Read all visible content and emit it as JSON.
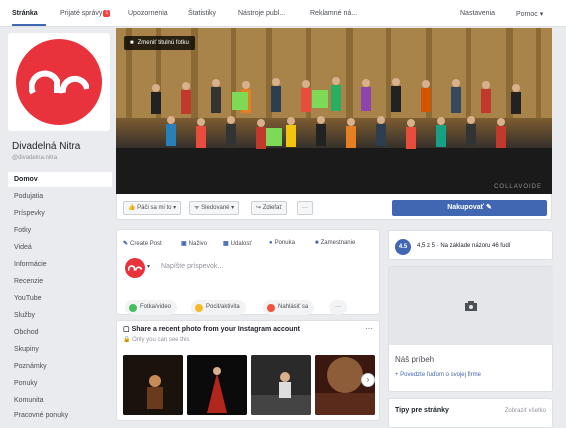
{
  "tabs": [
    "Stránka",
    "Prijaté správy",
    "Upozornenia",
    "Štatistiky",
    "Nástroje publ...",
    "Reklamné ná..."
  ],
  "tabs_badge": "1",
  "tabs_right": [
    "Nastavenia",
    "Pomoc ▾"
  ],
  "page": {
    "name": "Divadelná Nitra",
    "handle": "@divadelna.nitra"
  },
  "nav": [
    "Domov",
    "Podujatia",
    "Príspevky",
    "Fotky",
    "Videá",
    "Informácie",
    "Recenzie",
    "YouTube",
    "Služby",
    "Obchod",
    "Skupiny",
    "Poznámky",
    "Ponuky",
    "Komunita",
    "Pracovné ponuky"
  ],
  "cover": {
    "change_label": "Zmeniť titulnú fotku",
    "watermark": "COLLAVOIDE"
  },
  "actions": {
    "like": "Páči sa mi to ▾",
    "follow": "Sledované ▾",
    "share": "Zdieľať",
    "more": "···",
    "buy": "Nakupovať ✎"
  },
  "composer": {
    "create_post": "Create Post",
    "live": "Naživo",
    "event": "Udalosť",
    "offer": "Ponuka",
    "job": "Zamestnanie",
    "placeholder": "Napíšte príspevok...",
    "photo_video": "Fotka/video",
    "feeling": "Pocit/aktivita",
    "checkin": "Nahlásiť sa",
    "more": "···"
  },
  "instagram": {
    "title": "Share a recent photo from your Instagram account",
    "subtitle": "Only you can see this",
    "menu": "···",
    "next": "›"
  },
  "rating": {
    "score": "4.5",
    "text": "4,5 z 5 · Na základe názoru 46 ľudí"
  },
  "story": {
    "title": "Náš príbeh",
    "link": "+ Povedzte ľuďom o svojej firme"
  },
  "tips": {
    "title": "Tipy pre stránky",
    "link": "Zobraziť všetko"
  },
  "colors": {
    "brand": "#e8323c",
    "accent": "#4267b2"
  }
}
